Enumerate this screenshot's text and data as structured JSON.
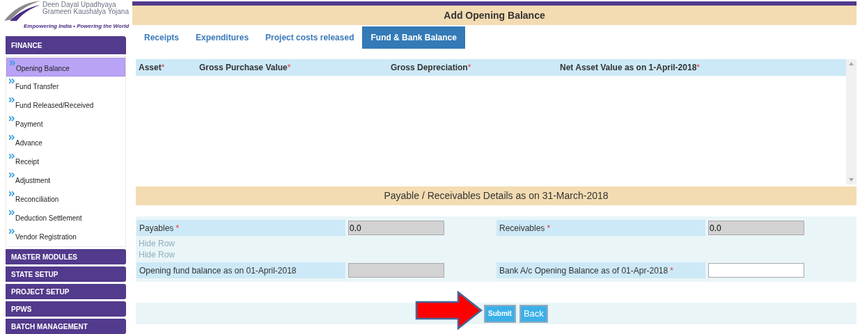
{
  "logo": {
    "line1": "Deen Dayal Upadhyaya",
    "line2": "Grameen Kaushalya Yojana",
    "tagline": "Empowering India • Powering the World"
  },
  "header": {
    "title": "Add Opening Balance"
  },
  "sidebar": {
    "sections": [
      {
        "label": "FINANCE",
        "items": [
          {
            "label": "Opening Balance",
            "selected": true
          },
          {
            "label": "Fund Transfer",
            "selected": false
          },
          {
            "label": "Fund Released/Received",
            "selected": false
          },
          {
            "label": "Payment",
            "selected": false
          },
          {
            "label": "Advance",
            "selected": false
          },
          {
            "label": "Receipt",
            "selected": false
          },
          {
            "label": "Adjustment",
            "selected": false
          },
          {
            "label": "Reconciliation",
            "selected": false
          },
          {
            "label": "Deduction Settlement",
            "selected": false
          },
          {
            "label": "Vendor Registration",
            "selected": false
          }
        ]
      },
      {
        "label": "MASTER MODULES"
      },
      {
        "label": "STATE SETUP"
      },
      {
        "label": "PROJECT SETUP"
      },
      {
        "label": "PPWS"
      },
      {
        "label": "BATCH MANAGEMENT"
      }
    ]
  },
  "tabs": [
    {
      "label": "Receipts",
      "selected": false
    },
    {
      "label": "Expenditures",
      "selected": false
    },
    {
      "label": "Project costs released",
      "selected": false
    },
    {
      "label": "Fund & Bank Balance",
      "selected": true
    }
  ],
  "table": {
    "columns": [
      {
        "label": "Asset",
        "mark": "*"
      },
      {
        "label": "Gross Purchase Value",
        "mark": "*"
      },
      {
        "label": "Gross Depreciation",
        "mark": "*"
      },
      {
        "label": "Net Asset Value as on 1-April-2018",
        "mark": "*"
      }
    ]
  },
  "section": {
    "title": "Payable / Receivables Details as on 31-March-2018"
  },
  "form_rows": [
    {
      "kind": "fields",
      "fields": [
        {
          "label": "Payables",
          "mark": "*",
          "value": "0.0",
          "disabled": true
        },
        {
          "label": "Receivables",
          "mark": "*",
          "value": "0.0",
          "disabled": true
        }
      ]
    },
    {
      "kind": "note",
      "text": "Hide Row"
    },
    {
      "kind": "note",
      "text": "Hide Row"
    },
    {
      "kind": "fields",
      "fields": [
        {
          "label": "Opening fund balance as on 01-April-2018",
          "disabled": true
        },
        {
          "label": "Bank A/c Opening Balance as of 01-Apr-2018",
          "mark": "*",
          "disabled": false
        }
      ]
    }
  ],
  "buttons": [
    {
      "label": "Submit"
    },
    {
      "label": "Back"
    }
  ]
}
